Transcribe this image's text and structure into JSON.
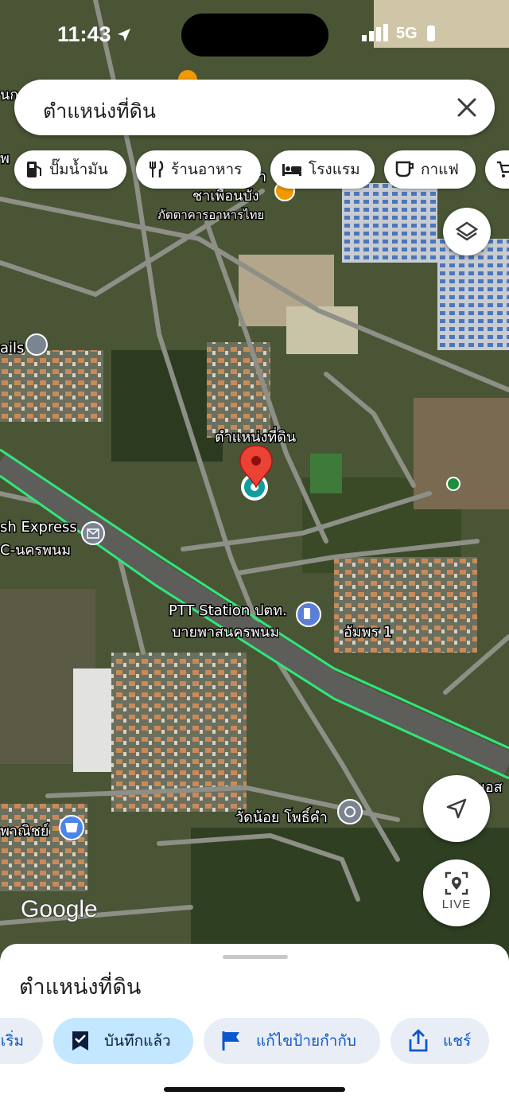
{
  "status_bar": {
    "time": "11:43",
    "network": "5G"
  },
  "search": {
    "query": "ตำแหน่งที่ดิน"
  },
  "chips": [
    {
      "label": "ปั๊มน้ำมัน",
      "icon": "gas-station-icon"
    },
    {
      "label": "ร้านอาหาร",
      "icon": "restaurant-icon"
    },
    {
      "label": "โรงแรม",
      "icon": "hotel-icon"
    },
    {
      "label": "กาแฟ",
      "icon": "coffee-icon"
    }
  ],
  "map": {
    "pin_label": "ตำแหน่งที่ดิน",
    "places": {
      "cha_line1": "ชาเพื่อนบัง",
      "cha_line2": "ภัตตาคารอาหารไทย",
      "cha_prefix": "า",
      "ptt_line1": "PTT Station ปตท.",
      "ptt_line2": "บายพาสนครพนม",
      "ampon": "อัมพร 1",
      "wat": "วัดน้อย โพธิ์คำ",
      "flash_line1": "sh Express",
      "flash_line2": "C-นครพนม",
      "commerce": "พาณิชย์",
      "ails": "ails",
      "left_top": "นก",
      "left_w": "พ",
      "right_edge": "มอส"
    },
    "logo": "Google",
    "colors": {
      "pin": "#ea4335",
      "route": "#2ee87a",
      "location": "#0f9d9d"
    }
  },
  "controls": {
    "live_label": "LIVE"
  },
  "sheet": {
    "title": "ตำแหน่งที่ดิน",
    "actions": [
      {
        "label": "เริ่ม",
        "icon": "navigation-icon"
      },
      {
        "label": "บันทึกแล้ว",
        "icon": "bookmark-check-icon"
      },
      {
        "label": "แก้ไขป้ายกำกับ",
        "icon": "flag-icon"
      },
      {
        "label": "แชร์",
        "icon": "share-icon"
      }
    ]
  }
}
